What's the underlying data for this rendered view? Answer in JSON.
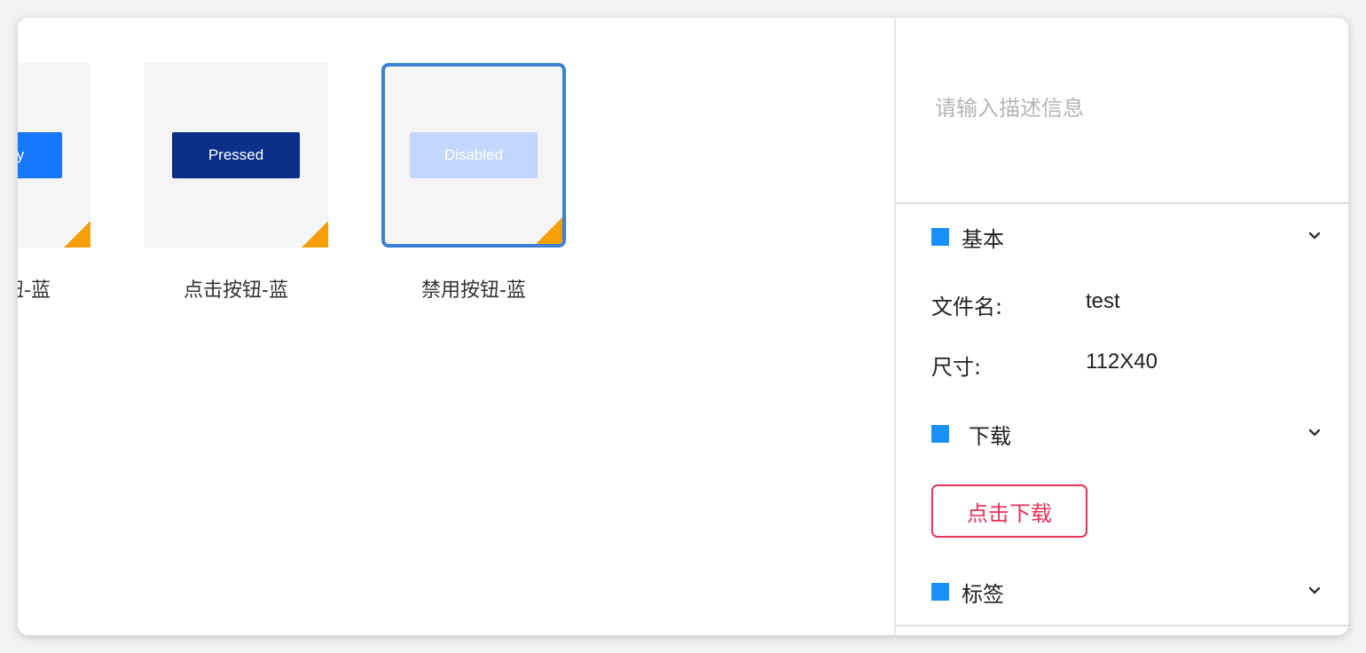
{
  "gallery": {
    "cards": [
      {
        "button_text": "Primary",
        "caption": "默认按钮-蓝"
      },
      {
        "button_text": "Pressed",
        "caption": "点击按钮-蓝"
      },
      {
        "button_text": "Disabled",
        "caption": "禁用按钮-蓝"
      }
    ]
  },
  "panel": {
    "description_placeholder": "请输入描述信息",
    "basic": {
      "title": "基本",
      "filename_label": "文件名:",
      "filename_value": "test",
      "size_label": "尺寸:",
      "size_value": "112X40"
    },
    "download": {
      "title": "下载",
      "button_label": "点击下载"
    },
    "tags": {
      "title": "标签"
    }
  },
  "colors": {
    "accent": "#1890ff",
    "selection_border": "#3b82d4",
    "download_button": "#e8315b",
    "corner_badge": "#f5a00b",
    "primary_button": "#1677ff",
    "pressed_button": "#0a2f88",
    "disabled_button": "#c3d7ff"
  }
}
